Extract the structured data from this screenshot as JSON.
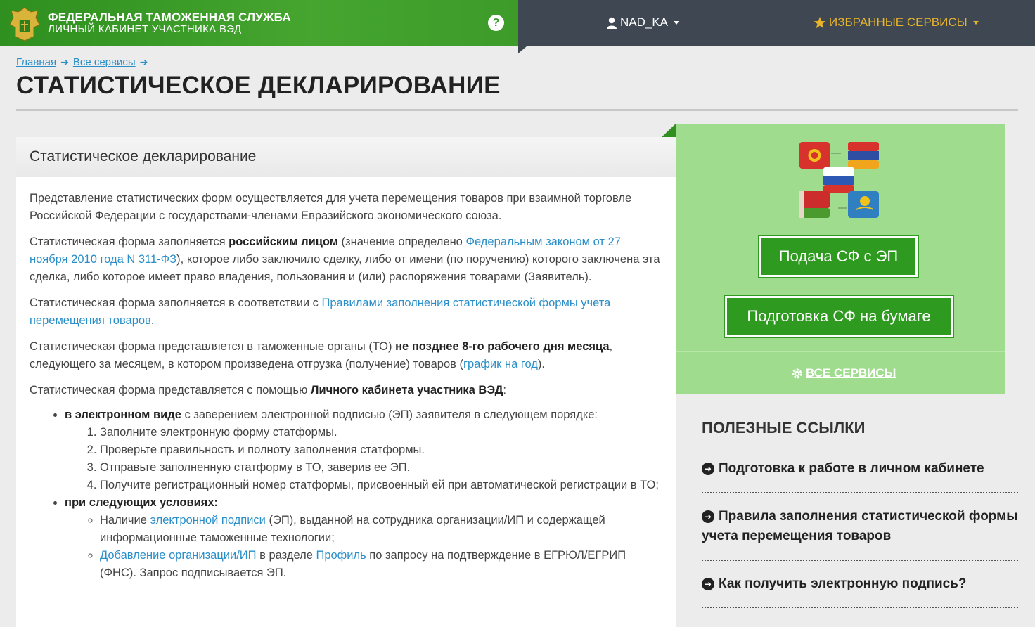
{
  "header": {
    "brand_title": "ФЕДЕРАЛЬНАЯ ТАМОЖЕННАЯ СЛУЖБА",
    "brand_sub": "ЛИЧНЫЙ КАБИНЕТ УЧАСТНИКА ВЭД",
    "help_label": "?",
    "user_name": "NAD_KA",
    "favorites_label": "ИЗБРАННЫЕ СЕРВИСЫ"
  },
  "breadcrumb": [
    {
      "label": "Главная"
    },
    {
      "label": "Все сервисы"
    }
  ],
  "page_title": "СТАТИСТИЧЕСКОЕ ДЕКЛАРИРОВАНИЕ",
  "content": {
    "heading": "Статистическое декларирование",
    "p1": "Представление статистических форм осуществляется для учета перемещения товаров при взаимной торговле Российской Федерации с государствами-членами Евразийского экономического союза.",
    "p2_a": "Статистическая форма заполняется ",
    "p2_b": "российским лицом",
    "p2_c": " (значение определено ",
    "p2_link": "Федеральным законом от 27 ноября 2010 года N 311-ФЗ",
    "p2_d": "), которое либо заключило сделку, либо от имени (по поручению) которого заключена эта сделка, либо которое имеет право владения, пользования и (или) распоряжения товарами (Заявитель).",
    "p3_a": "Статистическая форма заполняется в соответствии с ",
    "p3_link": "Правилами заполнения статистической формы учета перемещения товаров",
    "p3_b": ".",
    "p4_a": "Статистическая форма представляется в таможенные органы (ТО) ",
    "p4_b": "не позднее 8-го рабочего дня месяца",
    "p4_c": ", следующего за месяцем, в котором произведена отгрузка (получение) товаров (",
    "p4_link": "график на год",
    "p4_d": ").",
    "p5_a": "Статистическая форма представляется с помощью ",
    "p5_b": "Личного кабинета участника ВЭД",
    "p5_c": ":",
    "li1_b": "в электронном виде",
    "li1_rest": " с заверением электронной подписью (ЭП) заявителя в следующем порядке:",
    "steps": [
      "Заполните электронную форму статформы.",
      "Проверьте правильность и полноту заполнения статформы.",
      "Отправьте заполненную статформу в ТО, заверив ее ЭП.",
      "Получите регистрационный номер статформы, присвоенный ей при автоматической регистрации в ТО;"
    ],
    "li2_b": "при следующих условиях:",
    "cond1_a": "Наличие ",
    "cond1_link": "электронной подписи",
    "cond1_b": " (ЭП), выданной на сотрудника организации/ИП и содержащей информационные таможенные технологии;",
    "cond2_link1": "Добавление организации/ИП",
    "cond2_a": " в разделе ",
    "cond2_link2": "Профиль",
    "cond2_b": " по запросу на подтверждение в ЕГРЮЛ/ЕГРИП (ФНС). Запрос подписывается ЭП."
  },
  "side": {
    "btn_ep": "Подача СФ с ЭП",
    "btn_paper": "Подготовка СФ на бумаге",
    "all_services": "ВСЕ СЕРВИСЫ"
  },
  "useful": {
    "title": "ПОЛЕЗНЫЕ ССЫЛКИ",
    "links": [
      "Подготовка к работе в личном кабинете",
      "Правила заполнения статистической формы учета перемещения товаров",
      "Как получить электронную подпись?"
    ]
  },
  "colors": {
    "brand_green": "#3a9a2a",
    "dark_bar": "#3f4852",
    "favorites_gold": "#e8b42b",
    "link_blue": "#2a8fc9",
    "panel_green": "#9fdc8e",
    "button_green": "#2e9a1f"
  },
  "icons": {
    "emblem": "customs-emblem-icon",
    "user": "user-icon",
    "star": "star-icon",
    "gear": "gear-icon",
    "arrow": "arrow-right-circle-icon"
  }
}
